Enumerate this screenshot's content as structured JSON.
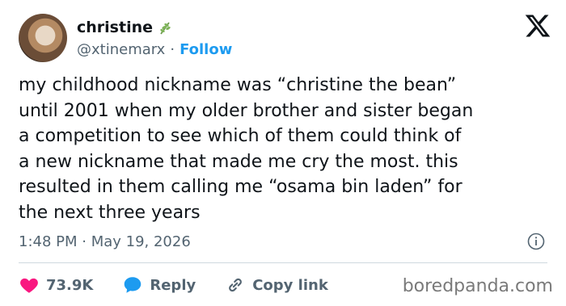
{
  "author": {
    "name": "christine",
    "handle": "@xtinemarx",
    "separator": "·",
    "follow_label": "Follow"
  },
  "tweet": {
    "text": "my childhood nickname was “christine the bean”\nuntil 2001 when my older brother and sister began\na competition to see which of them could think of\na new nickname that made me cry the most. this\nresulted in them calling me “osama bin laden” for\nthe next three years",
    "timestamp": "1:48 PM · May 19, 2026"
  },
  "actions": {
    "likes": "73.9K",
    "reply_label": "Reply",
    "copy_link_label": "Copy link"
  },
  "watermark": "boredpanda.com",
  "colors": {
    "accent": "#1d9bf0",
    "heart": "#f91880",
    "text": "#0f1419",
    "muted": "#536471"
  },
  "icons": [
    "avatar",
    "leaf-icon",
    "x-logo-icon",
    "info-icon",
    "heart-icon",
    "reply-icon",
    "link-icon"
  ]
}
